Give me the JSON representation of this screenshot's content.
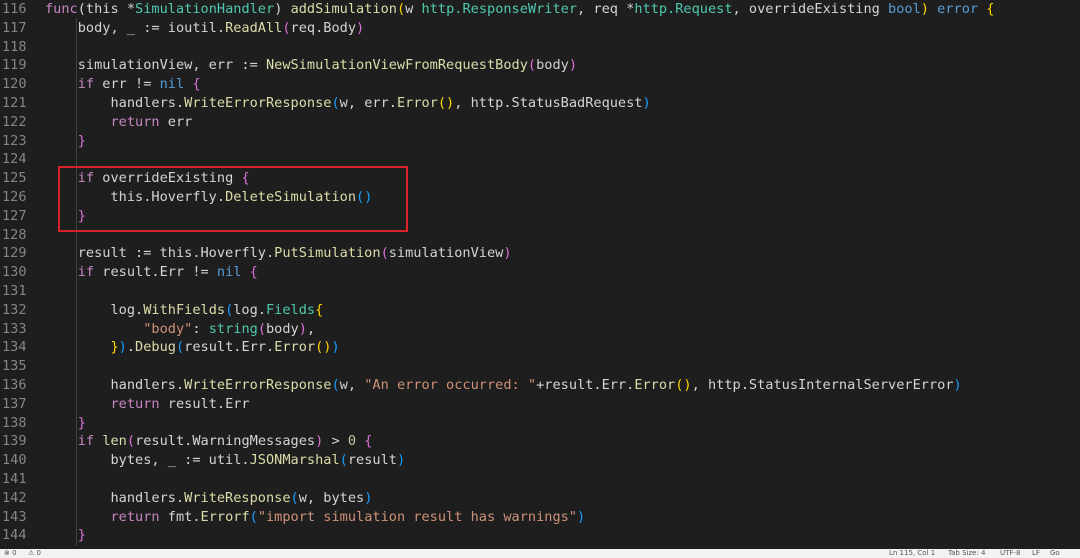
{
  "editor": {
    "lines": [
      {
        "n": "116",
        "tokens": [
          [
            "kw",
            "func"
          ],
          [
            "",
            "(this *"
          ],
          [
            "ty",
            "SimulationHandler"
          ],
          [
            "",
            ") "
          ],
          [
            "fn",
            "addSimulation"
          ],
          [
            "br1",
            "("
          ],
          [
            "",
            "w "
          ],
          [
            "ty",
            "http.ResponseWriter"
          ],
          [
            "",
            ", req *"
          ],
          [
            "ty",
            "http.Request"
          ],
          [
            "",
            ", overrideExisting "
          ],
          [
            "kw2",
            "bool"
          ],
          [
            "br1",
            ")"
          ],
          [
            "",
            " "
          ],
          [
            "kw2",
            "error"
          ],
          [
            "",
            " "
          ],
          [
            "br1",
            "{"
          ]
        ]
      },
      {
        "n": "117",
        "tokens": [
          [
            "",
            "    body, _ := ioutil."
          ],
          [
            "fn",
            "ReadAll"
          ],
          [
            "br2",
            "("
          ],
          [
            "",
            "req.Body"
          ],
          [
            "br2",
            ")"
          ]
        ]
      },
      {
        "n": "118",
        "tokens": []
      },
      {
        "n": "119",
        "tokens": [
          [
            "",
            "    simulationView, err := "
          ],
          [
            "fn",
            "NewSimulationViewFromRequestBody"
          ],
          [
            "br2",
            "("
          ],
          [
            "",
            "body"
          ],
          [
            "br2",
            ")"
          ]
        ]
      },
      {
        "n": "120",
        "tokens": [
          [
            "",
            "    "
          ],
          [
            "kw",
            "if"
          ],
          [
            "",
            " err != "
          ],
          [
            "kw2",
            "nil"
          ],
          [
            "",
            " "
          ],
          [
            "br2",
            "{"
          ]
        ]
      },
      {
        "n": "121",
        "tokens": [
          [
            "",
            "        handlers."
          ],
          [
            "fn",
            "WriteErrorResponse"
          ],
          [
            "br3",
            "("
          ],
          [
            "",
            "w, err."
          ],
          [
            "fn",
            "Error"
          ],
          [
            "br1",
            "()"
          ],
          [
            "",
            ", http.StatusBadRequest"
          ],
          [
            "br3",
            ")"
          ]
        ]
      },
      {
        "n": "122",
        "tokens": [
          [
            "",
            "        "
          ],
          [
            "kw",
            "return"
          ],
          [
            "",
            " err"
          ]
        ]
      },
      {
        "n": "123",
        "tokens": [
          [
            "",
            "    "
          ],
          [
            "br2",
            "}"
          ]
        ]
      },
      {
        "n": "124",
        "tokens": []
      },
      {
        "n": "125",
        "tokens": [
          [
            "",
            "    "
          ],
          [
            "kw",
            "if"
          ],
          [
            "",
            " overrideExisting "
          ],
          [
            "br2",
            "{"
          ]
        ]
      },
      {
        "n": "126",
        "tokens": [
          [
            "",
            "        this.Hoverfly."
          ],
          [
            "fn",
            "DeleteSimulation"
          ],
          [
            "br3",
            "()"
          ]
        ]
      },
      {
        "n": "127",
        "tokens": [
          [
            "",
            "    "
          ],
          [
            "br2",
            "}"
          ]
        ]
      },
      {
        "n": "128",
        "tokens": []
      },
      {
        "n": "129",
        "tokens": [
          [
            "",
            "    result := this.Hoverfly."
          ],
          [
            "fn",
            "PutSimulation"
          ],
          [
            "br2",
            "("
          ],
          [
            "",
            "simulationView"
          ],
          [
            "br2",
            ")"
          ]
        ]
      },
      {
        "n": "130",
        "tokens": [
          [
            "",
            "    "
          ],
          [
            "kw",
            "if"
          ],
          [
            "",
            " result.Err != "
          ],
          [
            "kw2",
            "nil"
          ],
          [
            "",
            " "
          ],
          [
            "br2",
            "{"
          ]
        ]
      },
      {
        "n": "131",
        "tokens": []
      },
      {
        "n": "132",
        "tokens": [
          [
            "",
            "        log."
          ],
          [
            "fn",
            "WithFields"
          ],
          [
            "br3",
            "("
          ],
          [
            "",
            "log."
          ],
          [
            "ty",
            "Fields"
          ],
          [
            "br1",
            "{"
          ]
        ]
      },
      {
        "n": "133",
        "tokens": [
          [
            "",
            "            "
          ],
          [
            "st",
            "\"body\""
          ],
          [
            "",
            ": "
          ],
          [
            "ty",
            "string"
          ],
          [
            "br2",
            "("
          ],
          [
            "",
            "body"
          ],
          [
            "br2",
            ")"
          ],
          [
            "",
            ","
          ]
        ]
      },
      {
        "n": "134",
        "tokens": [
          [
            "",
            "        "
          ],
          [
            "br1",
            "}"
          ],
          [
            "br3",
            ")"
          ],
          [
            "",
            "."
          ],
          [
            "fn",
            "Debug"
          ],
          [
            "br3",
            "("
          ],
          [
            "",
            "result.Err."
          ],
          [
            "fn",
            "Error"
          ],
          [
            "br1",
            "()"
          ],
          [
            "br3",
            ")"
          ]
        ]
      },
      {
        "n": "135",
        "tokens": []
      },
      {
        "n": "136",
        "tokens": [
          [
            "",
            "        handlers."
          ],
          [
            "fn",
            "WriteErrorResponse"
          ],
          [
            "br3",
            "("
          ],
          [
            "",
            "w, "
          ],
          [
            "st",
            "\"An error occurred: \""
          ],
          [
            "",
            "+result.Err."
          ],
          [
            "fn",
            "Error"
          ],
          [
            "br1",
            "()"
          ],
          [
            "",
            ", http.StatusInternalServerError"
          ],
          [
            "br3",
            ")"
          ]
        ]
      },
      {
        "n": "137",
        "tokens": [
          [
            "",
            "        "
          ],
          [
            "kw",
            "return"
          ],
          [
            "",
            " result.Err"
          ]
        ]
      },
      {
        "n": "138",
        "tokens": [
          [
            "",
            "    "
          ],
          [
            "br2",
            "}"
          ]
        ]
      },
      {
        "n": "139",
        "tokens": [
          [
            "",
            "    "
          ],
          [
            "kw",
            "if"
          ],
          [
            "",
            " "
          ],
          [
            "fn",
            "len"
          ],
          [
            "br2",
            "("
          ],
          [
            "",
            "result.WarningMessages"
          ],
          [
            "br2",
            ")"
          ],
          [
            "",
            " > "
          ],
          [
            "nu",
            "0"
          ],
          [
            "",
            " "
          ],
          [
            "br2",
            "{"
          ]
        ]
      },
      {
        "n": "140",
        "tokens": [
          [
            "",
            "        bytes, _ := util."
          ],
          [
            "fn",
            "JSONMarshal"
          ],
          [
            "br3",
            "("
          ],
          [
            "",
            "result"
          ],
          [
            "br3",
            ")"
          ]
        ]
      },
      {
        "n": "141",
        "tokens": []
      },
      {
        "n": "142",
        "tokens": [
          [
            "",
            "        handlers."
          ],
          [
            "fn",
            "WriteResponse"
          ],
          [
            "br3",
            "("
          ],
          [
            "",
            "w, bytes"
          ],
          [
            "br3",
            ")"
          ]
        ]
      },
      {
        "n": "143",
        "tokens": [
          [
            "",
            "        "
          ],
          [
            "kw",
            "return"
          ],
          [
            "",
            " fmt."
          ],
          [
            "fn",
            "Errorf"
          ],
          [
            "br3",
            "("
          ],
          [
            "st",
            "\"import simulation result has warnings\""
          ],
          [
            "br3",
            ")"
          ]
        ]
      },
      {
        "n": "144",
        "tokens": [
          [
            "",
            "    "
          ],
          [
            "br2",
            "}"
          ]
        ]
      }
    ]
  },
  "statusbar": {
    "errors": "⊗ 0",
    "warnings": "⚠ 0",
    "position": "Ln 115, Col 1",
    "tab_size": "Tab Size: 4",
    "encoding": "UTF-8",
    "eol": "LF",
    "language": "Go"
  },
  "colors": {
    "background": "#1e1e1e",
    "highlight_box": "#d9232a",
    "line_number": "#858585"
  }
}
